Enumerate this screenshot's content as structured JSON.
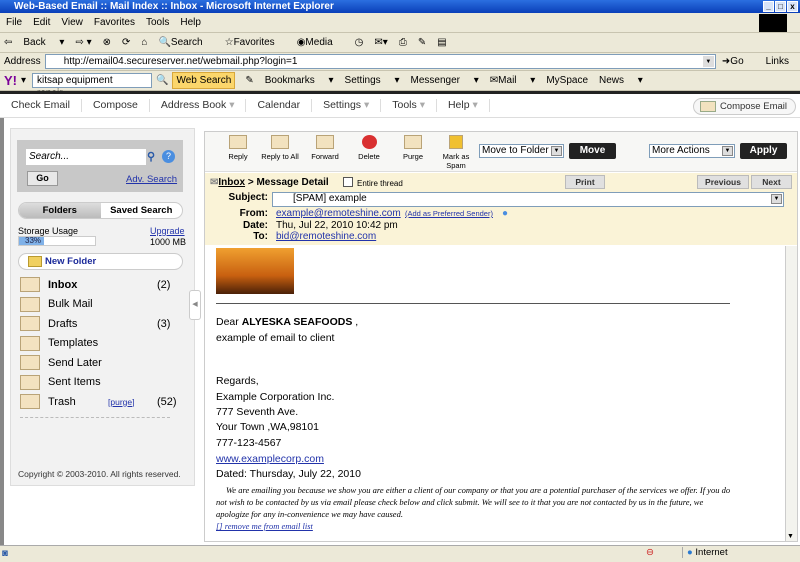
{
  "window": {
    "title": "Web-Based Email :: Mail Index :: Inbox - Microsoft Internet Explorer"
  },
  "ie": {
    "menu": [
      "File",
      "Edit",
      "View",
      "Favorites",
      "Tools",
      "Help"
    ],
    "toolbar": {
      "back": "Back",
      "search": "Search",
      "favorites": "Favorites",
      "media": "Media"
    },
    "address_label": "Address",
    "url": "http://email04.secureserver.net/webmail.php?login=1",
    "go": "Go",
    "links": "Links"
  },
  "yahoo": {
    "query": "kitsap equipment repair",
    "web_search": "Web Search",
    "bookmarks": "Bookmarks",
    "settings": "Settings",
    "messenger": "Messenger",
    "mail": "Mail",
    "myspace": "MySpace",
    "news": "News"
  },
  "nav": {
    "items": [
      "Check Email",
      "Compose",
      "Address Book",
      "Calendar",
      "Settings",
      "Tools",
      "Help"
    ],
    "compose_email": "Compose Email"
  },
  "sidebar": {
    "search_placeholder": "Search...",
    "go": "Go",
    "adv_search": "Adv. Search",
    "tabs": [
      "Folders",
      "Saved Search"
    ],
    "storage_label": "Storage Usage",
    "upgrade": "Upgrade",
    "storage_percent": "33%",
    "storage_fraction": 0.33,
    "storage_total": "1000 MB",
    "new_folder": "New Folder",
    "folders": [
      {
        "name": "Inbox",
        "count": "(2)"
      },
      {
        "name": "Bulk Mail",
        "count": ""
      },
      {
        "name": "Drafts",
        "count": "(3)"
      },
      {
        "name": "Templates",
        "count": ""
      },
      {
        "name": "Send Later",
        "count": ""
      },
      {
        "name": "Sent Items",
        "count": ""
      },
      {
        "name": "Trash",
        "count": "(52)",
        "purge": "[purge]"
      }
    ],
    "copyright": "Copyright © 2003-2010. All rights reserved."
  },
  "toolbar": {
    "reply": "Reply",
    "reply_all": "Reply to All",
    "forward": "Forward",
    "delete": "Delete",
    "purge": "Purge",
    "mark_spam": "Mark as Spam",
    "move_folder": "Move to Folder",
    "move": "Move",
    "more_actions": "More Actions",
    "apply": "Apply"
  },
  "message": {
    "breadcrumb_inbox": "Inbox",
    "breadcrumb_rest": " > Message Detail",
    "entire_thread": "Entire thread",
    "print": "Print",
    "previous": "Previous",
    "next": "Next",
    "subject_label": "Subject:",
    "subject": "[SPAM] example",
    "from_label": "From:",
    "from": "example@remoteshine.com",
    "add_preferred": "(Add as Preferred Sender)",
    "date_label": "Date:",
    "date": "Thu, Jul 22, 2010 10:42 pm",
    "to_label": "To:",
    "to": "bid@remoteshine.com",
    "body": {
      "dear": "Dear ",
      "recipient": "ALYESKA SEAFOODS",
      " comma": " ,",
      "line1": "example of email to client",
      "regards": "Regards,",
      "company": "Example Corporation Inc.",
      "street": "777 Seventh Ave.",
      "city": "Your Town ,WA,98101",
      "phone": "777-123-4567",
      "website": "www.examplecorp.com",
      "dated": "Dated: Thursday, July 22, 2010",
      "disclaimer": "We are emailing you because we show you are either a client of our company or that you are a potential purchaser of the services we offer. If you do not wish to be contacted by us via email please check below and click submit. We will see to it that you are not contacted by us in the future, we apologize for any in-convenience we may have caused.",
      "remove": "[] remove me from email list"
    }
  },
  "status": {
    "zone": "Internet"
  }
}
